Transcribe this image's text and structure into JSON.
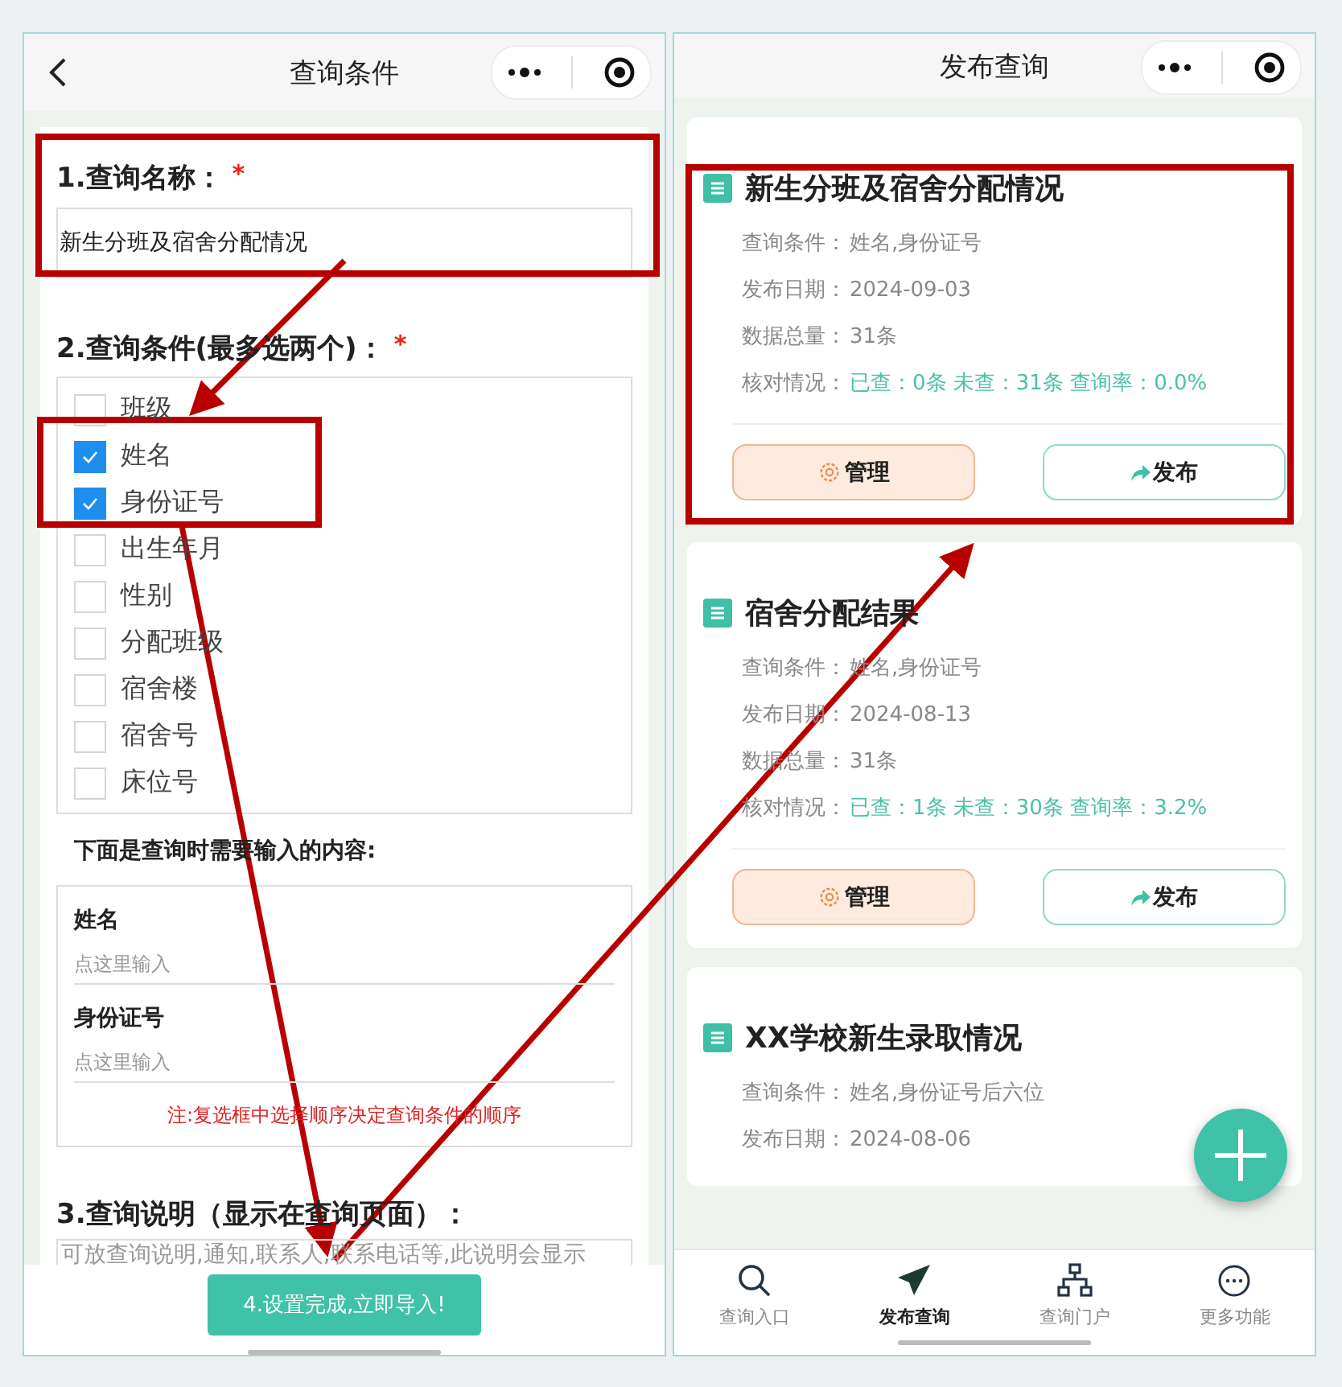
{
  "left": {
    "nav": {
      "title": "查询条件",
      "back_button": true
    },
    "name_field": {
      "label": "1.查询名称：",
      "required_mark": "*",
      "value": "新生分班及宿舍分配情况"
    },
    "conditions": {
      "label": "2.查询条件(最多选两个)：",
      "required_mark": "*",
      "options": [
        {
          "label": "班级",
          "checked": false
        },
        {
          "label": "姓名",
          "checked": true
        },
        {
          "label": "身份证号",
          "checked": true
        },
        {
          "label": "出生年月",
          "checked": false
        },
        {
          "label": "性别",
          "checked": false
        },
        {
          "label": "分配班级",
          "checked": false
        },
        {
          "label": "宿舍楼",
          "checked": false
        },
        {
          "label": "宿舍号",
          "checked": false
        },
        {
          "label": "床位号",
          "checked": false
        }
      ]
    },
    "inputs_heading": "下面是查询时需要输入的内容:",
    "inputs": [
      {
        "label": "姓名",
        "placeholder": "点这里输入"
      },
      {
        "label": "身份证号",
        "placeholder": "点这里输入"
      }
    ],
    "note": "注:复选框中选择顺序决定查询条件的顺序",
    "description": {
      "label": "3.查询说明（显示在查询页面）：",
      "placeholder": "可放查询说明,通知,联系人,联系电话等,此说明会显示"
    },
    "submit_button": "4.设置完成,立即导入!"
  },
  "right": {
    "nav": {
      "title": "发布查询"
    },
    "cards": [
      {
        "title": "新生分班及宿舍分配情况",
        "rows": [
          {
            "kind": "plain",
            "label": "查询条件：",
            "value": "姓名,身份证号"
          },
          {
            "kind": "plain",
            "label": "发布日期：",
            "value": "2024-09-03"
          },
          {
            "kind": "plain",
            "label": "数据总量：",
            "value": "31条"
          },
          {
            "kind": "status",
            "label": "核对情况：",
            "value": "已查：0条 未查：31条 查询率：0.0%"
          }
        ],
        "buttons": [
          {
            "kind": "manage",
            "label": "管理"
          },
          {
            "kind": "publish",
            "label": "发布"
          }
        ]
      },
      {
        "title": "宿舍分配结果",
        "rows": [
          {
            "kind": "plain",
            "label": "查询条件：",
            "value": "姓名,身份证号"
          },
          {
            "kind": "plain",
            "label": "发布日期：",
            "value": "2024-08-13"
          },
          {
            "kind": "plain",
            "label": "数据总量：",
            "value": "31条"
          },
          {
            "kind": "status",
            "label": "核对情况：",
            "value": "已查：1条 未查：30条 查询率：3.2%"
          }
        ],
        "buttons": [
          {
            "kind": "manage",
            "label": "管理"
          },
          {
            "kind": "publish",
            "label": "发布"
          }
        ]
      },
      {
        "title": "XX学校新生录取情况",
        "rows": [
          {
            "kind": "plain",
            "label": "查询条件：",
            "value": "姓名,身份证号后六位"
          },
          {
            "kind": "plain",
            "label": "发布日期：",
            "value": "2024-08-06"
          }
        ]
      }
    ],
    "tabs": [
      {
        "label": "查询入口",
        "selected": false
      },
      {
        "label": "发布查询",
        "selected": true
      },
      {
        "label": "查询门户",
        "selected": false
      },
      {
        "label": "更多功能",
        "selected": false
      }
    ]
  }
}
